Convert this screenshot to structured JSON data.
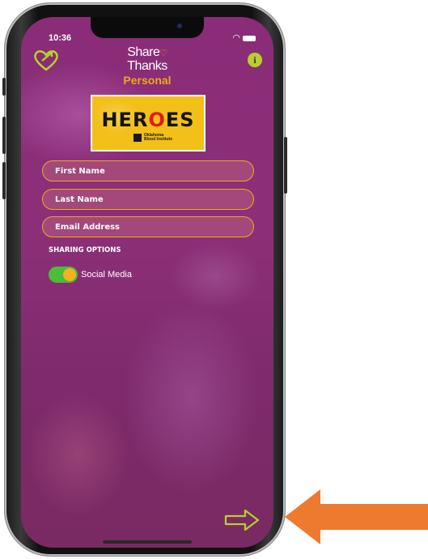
{
  "status_bar": {
    "time": "10:36"
  },
  "header": {
    "logo_line1": "Share",
    "logo_line2": "Thanks",
    "logo_sub": "Personal",
    "heart_icon": "heart-arrow-icon",
    "info_icon": "info-icon",
    "info_glyph": "i"
  },
  "banner": {
    "title_pre": "HER",
    "title_o": "O",
    "title_post": "ES",
    "org_line1": "Oklahoma",
    "org_line2": "Blood Institute"
  },
  "form": {
    "first_name": {
      "placeholder": "First Name",
      "value": ""
    },
    "last_name": {
      "placeholder": "Last Name",
      "value": ""
    },
    "email": {
      "placeholder": "Email Address",
      "value": ""
    }
  },
  "sharing": {
    "section_label": "SHARING OPTIONS",
    "social_media_label": "Social Media",
    "social_media_enabled": true
  },
  "colors": {
    "background": "#8a2c77",
    "accent": "#f0a818",
    "icon_green": "#b8d02b",
    "toggle_on": "#4bbd3a",
    "callout": "#ee7a30"
  },
  "footer": {
    "next_icon": "arrow-right-icon"
  },
  "annotation": {
    "callout_icon": "callout-arrow-left-icon"
  }
}
